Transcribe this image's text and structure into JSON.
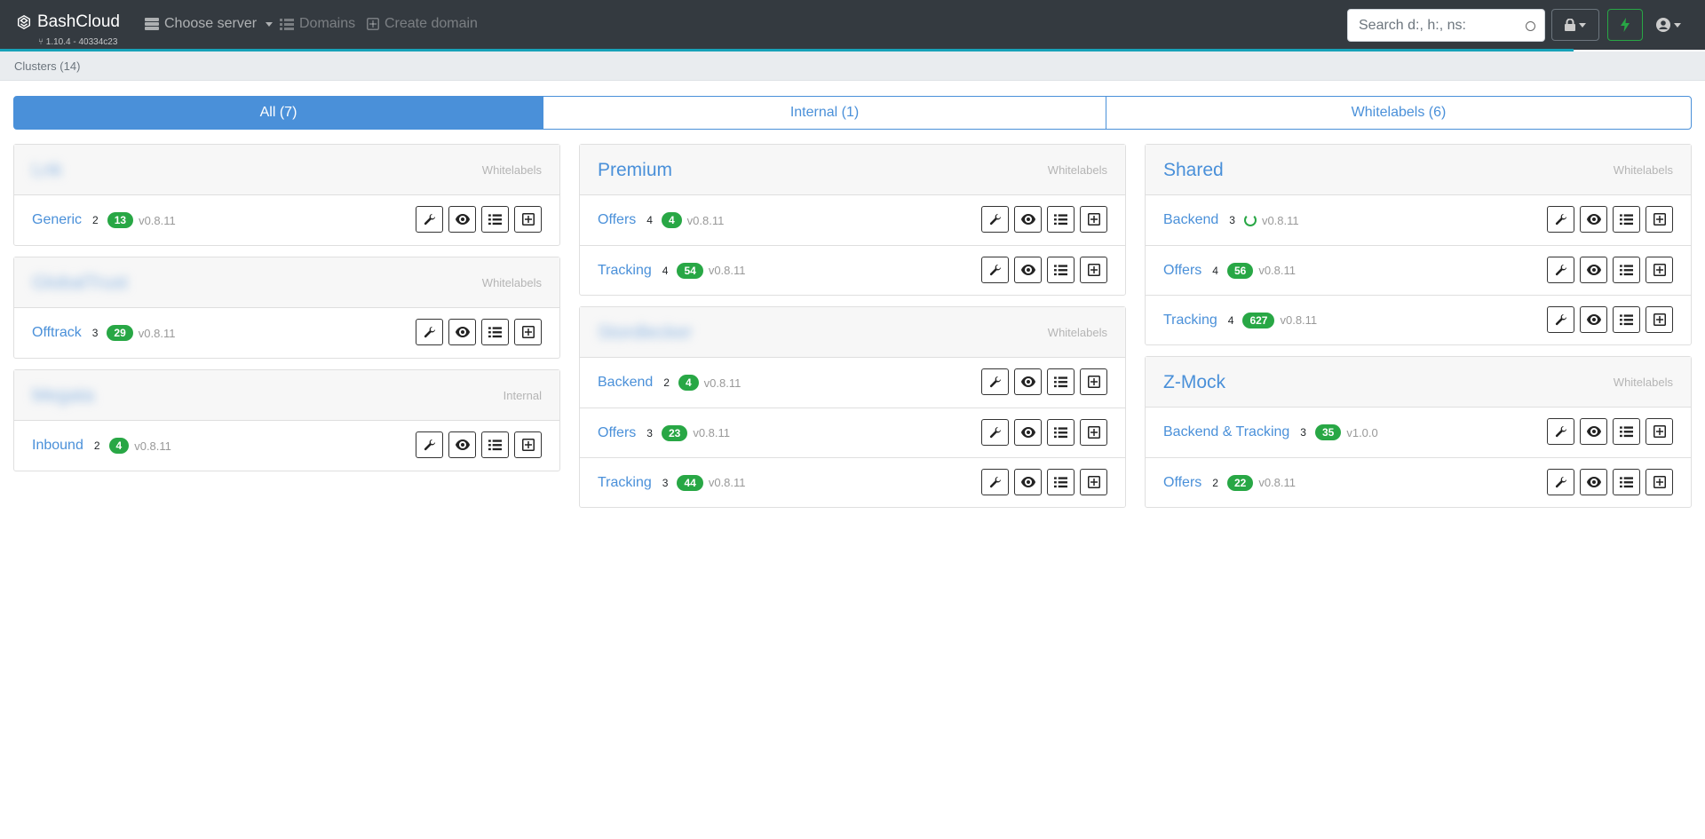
{
  "navbar": {
    "brand": "BashCloud",
    "version": "1.10.4 - 40334c23",
    "choose_server": "Choose server",
    "domains": "Domains",
    "create_domain": "Create domain",
    "search_placeholder": "Search d:, h:, ns:"
  },
  "breadcrumb": "Clusters (14)",
  "tabs": [
    {
      "label": "All (7)",
      "active": true
    },
    {
      "label": "Internal (1)",
      "active": false
    },
    {
      "label": "Whitelabels (6)",
      "active": false
    }
  ],
  "columns": [
    [
      {
        "title": "Lnk",
        "blurred": true,
        "type": "Whitelabels",
        "rows": [
          {
            "name": "Generic",
            "count": "2",
            "badge": "13",
            "version": "v0.8.11"
          }
        ]
      },
      {
        "title": "GlobalTrust",
        "blurred": true,
        "type": "Whitelabels",
        "rows": [
          {
            "name": "Offtrack",
            "count": "3",
            "badge": "29",
            "version": "v0.8.11"
          }
        ]
      },
      {
        "title": "Megata",
        "blurred": true,
        "type": "Internal",
        "rows": [
          {
            "name": "Inbound",
            "count": "2",
            "badge": "4",
            "version": "v0.8.11"
          }
        ]
      }
    ],
    [
      {
        "title": "Premium",
        "blurred": false,
        "type": "Whitelabels",
        "rows": [
          {
            "name": "Offers",
            "count": "4",
            "badge": "4",
            "version": "v0.8.11"
          },
          {
            "name": "Tracking",
            "count": "4",
            "badge": "54",
            "version": "v0.8.11"
          }
        ]
      },
      {
        "title": "Stordlecker",
        "blurred": true,
        "type": "Whitelabels",
        "rows": [
          {
            "name": "Backend",
            "count": "2",
            "badge": "4",
            "version": "v0.8.11"
          },
          {
            "name": "Offers",
            "count": "3",
            "badge": "23",
            "version": "v0.8.11"
          },
          {
            "name": "Tracking",
            "count": "3",
            "badge": "44",
            "version": "v0.8.11"
          }
        ]
      }
    ],
    [
      {
        "title": "Shared",
        "blurred": false,
        "type": "Whitelabels",
        "rows": [
          {
            "name": "Backend",
            "count": "3",
            "badge": null,
            "loading": true,
            "version": "v0.8.11"
          },
          {
            "name": "Offers",
            "count": "4",
            "badge": "56",
            "version": "v0.8.11"
          },
          {
            "name": "Tracking",
            "count": "4",
            "badge": "627",
            "version": "v0.8.11"
          }
        ]
      },
      {
        "title": "Z-Mock",
        "blurred": false,
        "type": "Whitelabels",
        "rows": [
          {
            "name": "Backend & Tracking",
            "count": "3",
            "badge": "35",
            "version": "v1.0.0"
          },
          {
            "name": "Offers",
            "count": "2",
            "badge": "22",
            "version": "v0.8.11"
          }
        ]
      }
    ]
  ],
  "row_actions": [
    "wrench-icon",
    "eye-icon",
    "list-icon",
    "plus-square-icon"
  ],
  "colors": {
    "navbar": "#343a40",
    "primary": "#4a90d9",
    "success": "#28a745",
    "progress": "#17a2b8"
  }
}
